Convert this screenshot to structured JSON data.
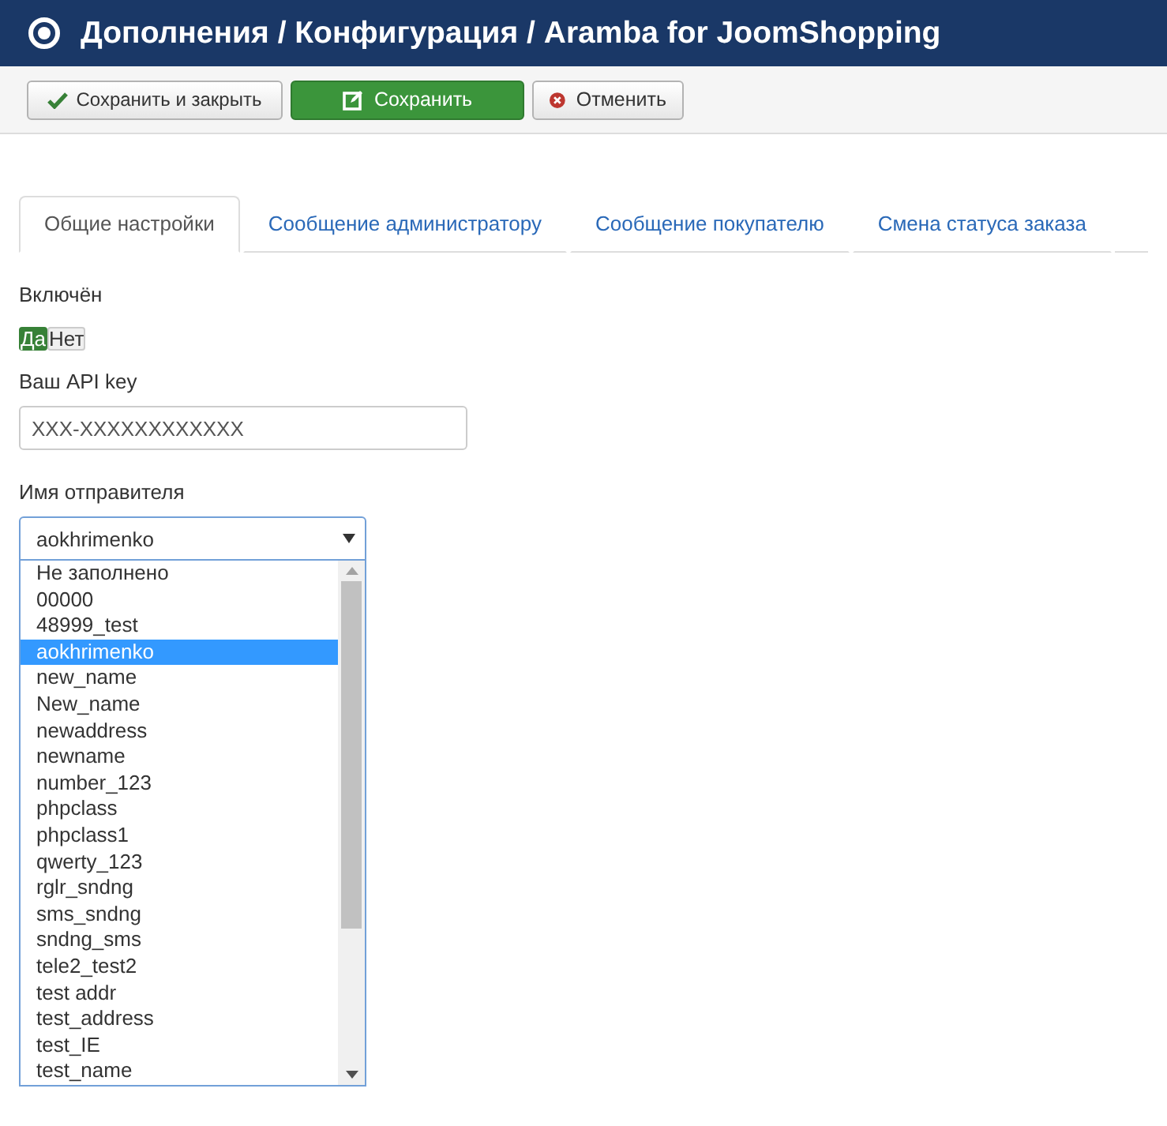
{
  "header": {
    "title": "Дополнения / Конфигурация / Aramba for JoomShopping"
  },
  "toolbar": [
    {
      "label": "Сохранить и закрыть",
      "kind": "save-close"
    },
    {
      "label": "Сохранить",
      "kind": "save"
    },
    {
      "label": "Отменить",
      "kind": "cancel"
    }
  ],
  "tabs": [
    {
      "label": "Общие настройки",
      "selected": true
    },
    {
      "label": "Сообщение администратору",
      "selected": false
    },
    {
      "label": "Сообщение покупателю",
      "selected": false
    },
    {
      "label": "Смена статуса заказа",
      "selected": false
    }
  ],
  "enabled": {
    "label": "Включён",
    "options": [
      {
        "label": "Да",
        "selected": true
      },
      {
        "label": "Нет",
        "selected": false
      }
    ]
  },
  "api_key": {
    "label": "Ваш API key",
    "value": "XXX-XXXXXXXXXXXX"
  },
  "sender": {
    "label": "Имя отправителя",
    "value": "aokhrimenko",
    "options": [
      {
        "label": "Не заполнено",
        "selected": false
      },
      {
        "label": "00000",
        "selected": false
      },
      {
        "label": "48999_test",
        "selected": false
      },
      {
        "label": "aokhrimenko",
        "selected": true
      },
      {
        "label": "new_name",
        "selected": false
      },
      {
        "label": "New_name",
        "selected": false
      },
      {
        "label": "newaddress",
        "selected": false
      },
      {
        "label": "newname",
        "selected": false
      },
      {
        "label": "number_123",
        "selected": false
      },
      {
        "label": "phpclass",
        "selected": false
      },
      {
        "label": "phpclass1",
        "selected": false
      },
      {
        "label": "qwerty_123",
        "selected": false
      },
      {
        "label": "rglr_sndng",
        "selected": false
      },
      {
        "label": "sms_sndng",
        "selected": false
      },
      {
        "label": "sndng_sms",
        "selected": false
      },
      {
        "label": "tele2_test2",
        "selected": false
      },
      {
        "label": "test addr",
        "selected": false
      },
      {
        "label": "test_address",
        "selected": false
      },
      {
        "label": "test_IE",
        "selected": false
      },
      {
        "label": "test_name",
        "selected": false
      }
    ]
  }
}
